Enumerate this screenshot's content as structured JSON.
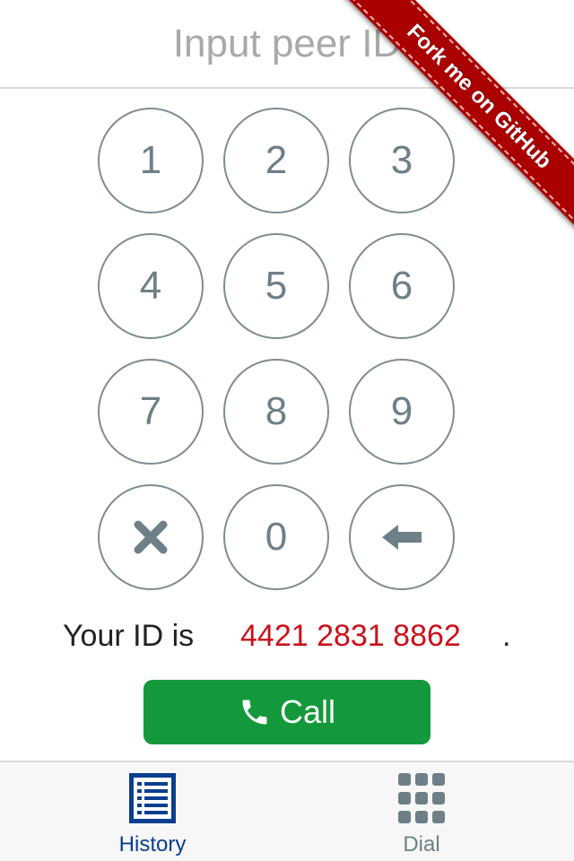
{
  "header": {
    "peer_input_placeholder": "Input peer ID",
    "peer_input_value": ""
  },
  "keypad": {
    "keys": [
      {
        "label": "1"
      },
      {
        "label": "2"
      },
      {
        "label": "3"
      },
      {
        "label": "4"
      },
      {
        "label": "5"
      },
      {
        "label": "6"
      },
      {
        "label": "7"
      },
      {
        "label": "8"
      },
      {
        "label": "9"
      },
      {
        "label": "",
        "icon": "close-icon"
      },
      {
        "label": "0"
      },
      {
        "label": "",
        "icon": "arrow-left-icon"
      }
    ]
  },
  "identity": {
    "label": "Your ID is",
    "value": "4421 2831 8862",
    "suffix": "."
  },
  "call": {
    "label": "Call",
    "icon": "phone-icon"
  },
  "tabbar": {
    "tabs": [
      {
        "label": "History",
        "icon": "list-icon",
        "active": true
      },
      {
        "label": "Dial",
        "icon": "grid-icon",
        "active": false
      }
    ]
  },
  "ribbon": {
    "label": "Fork me on GitHub"
  },
  "colors": {
    "key_border": "#7f8c92",
    "id_value": "#c9111a",
    "call_button": "#13993b",
    "active_tab": "#0b3e8e",
    "inactive_tab": "#6e7f87",
    "ribbon": "#aa0000"
  }
}
